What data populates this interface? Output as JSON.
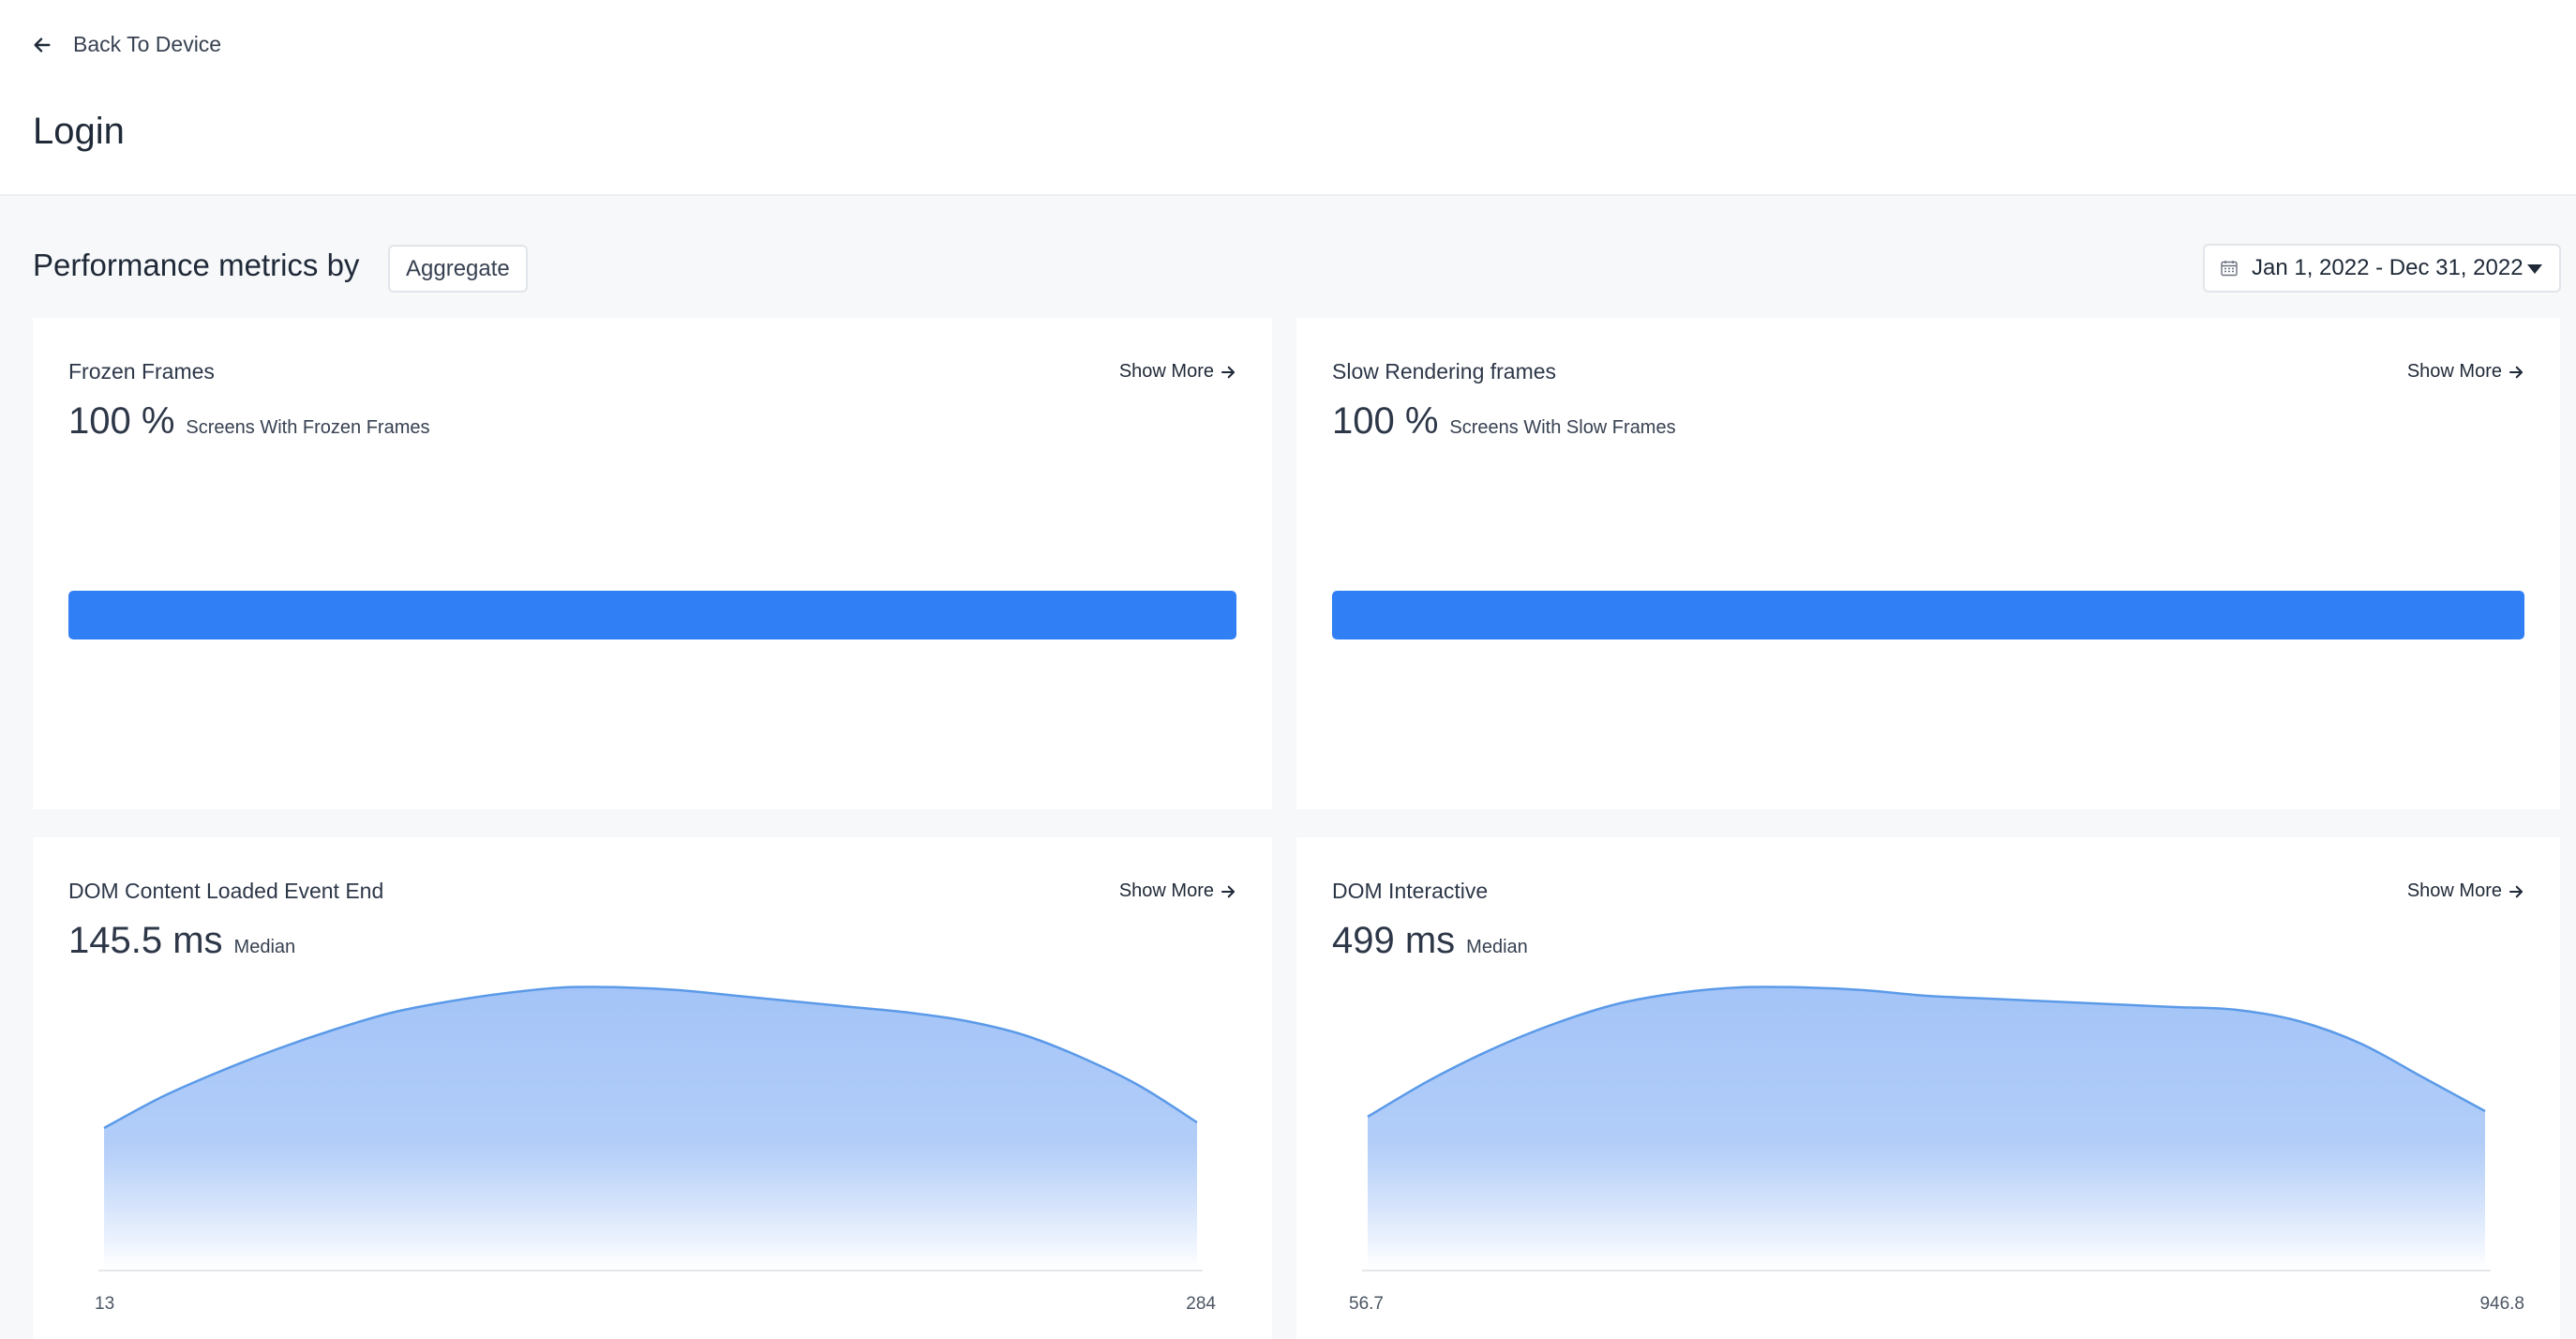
{
  "header": {
    "back_label": "Back To Device",
    "page_title": "Login"
  },
  "toolbar": {
    "metrics_title": "Performance metrics by",
    "aggregate_label": "Aggregate",
    "date_range": "Jan 1, 2022 - Dec 31, 2022"
  },
  "show_more_label": "Show More",
  "colors": {
    "accent": "#307ff5",
    "area_fill": "#a4c4f7",
    "area_stroke": "#5b9ae8"
  },
  "cards": {
    "frozen": {
      "title": "Frozen Frames",
      "value": "100 %",
      "sub": "Screens With Frozen Frames",
      "percent": 100
    },
    "slow": {
      "title": "Slow Rendering frames",
      "value": "100 %",
      "sub": "Screens With Slow Frames",
      "percent": 100
    },
    "dom_loaded": {
      "title": "DOM Content Loaded Event End",
      "value": "145.5 ms",
      "sub": "Median",
      "x_min": "13",
      "x_max": "284"
    },
    "dom_interactive": {
      "title": "DOM Interactive",
      "value": "499 ms",
      "sub": "Median",
      "x_min": "56.7",
      "x_max": "946.8"
    }
  },
  "chart_data": [
    {
      "type": "area",
      "title": "DOM Content Loaded Event End",
      "x_range": [
        13,
        284
      ],
      "values": [
        0.5,
        0.61,
        0.7,
        0.78,
        0.85,
        0.91,
        0.95,
        0.98,
        1.0,
        1.0,
        0.99,
        0.97,
        0.95,
        0.93,
        0.91,
        0.88,
        0.83,
        0.75,
        0.65,
        0.52
      ]
    },
    {
      "type": "area",
      "title": "DOM Interactive",
      "x_range": [
        56.7,
        946.8
      ],
      "values": [
        0.54,
        0.67,
        0.78,
        0.87,
        0.94,
        0.98,
        1.0,
        1.0,
        0.99,
        0.97,
        0.96,
        0.95,
        0.94,
        0.93,
        0.92,
        0.88,
        0.8,
        0.68,
        0.56
      ]
    }
  ]
}
